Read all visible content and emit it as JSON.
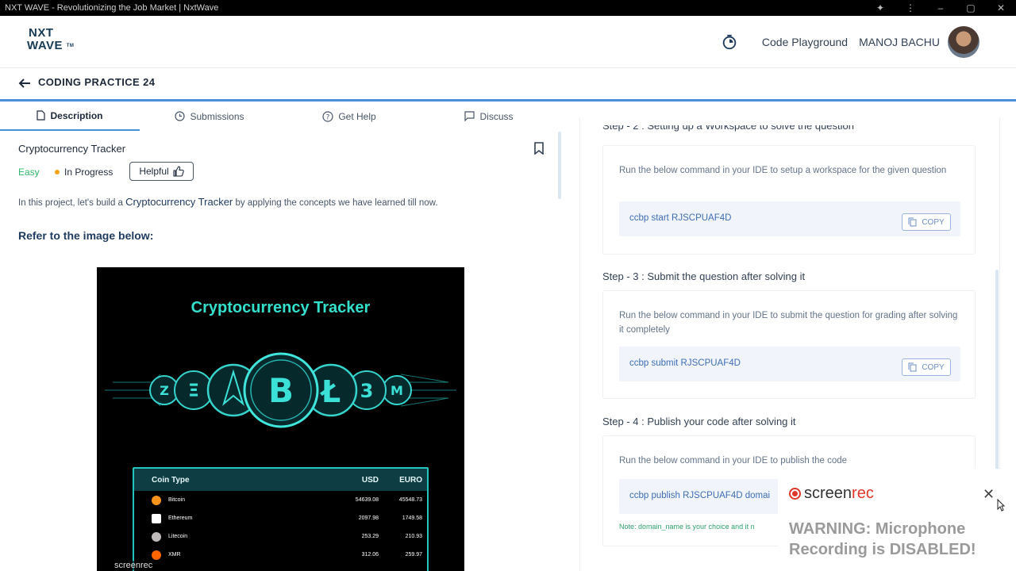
{
  "window": {
    "title": "NXT WAVE - Revolutionizing the Job Market | NxtWave"
  },
  "header": {
    "logo_line1": "NXT",
    "logo_line2": "WAVE",
    "logo_tm": "TM",
    "code_playground": "Code Playground",
    "username": "MANOJ BACHU"
  },
  "subheader": {
    "title": "CODING PRACTICE 24"
  },
  "tabs": [
    {
      "label": "Description"
    },
    {
      "label": "Submissions"
    },
    {
      "label": "Get Help"
    },
    {
      "label": "Discuss"
    }
  ],
  "question": {
    "title": "Cryptocurrency Tracker",
    "difficulty": "Easy",
    "status": "In Progress",
    "helpful_label": "Helpful",
    "intro_before": "In this project, let's build a ",
    "intro_strong": "Cryptocurrency Tracker",
    "intro_after": " by applying the concepts we have learned till now.",
    "refer": "Refer to the image below:"
  },
  "preview": {
    "title": "Cryptocurrency Tracker",
    "headers": [
      "Coin Type",
      "USD",
      "EURO"
    ],
    "rows": [
      {
        "name": "Bitcoin",
        "usd": "54639.08",
        "euro": "45548.73",
        "color": "#f7931a"
      },
      {
        "name": "Ethereum",
        "usd": "2097.98",
        "euro": "1749.58",
        "color": "#ffffff"
      },
      {
        "name": "Litecoin",
        "usd": "253.29",
        "euro": "210.93",
        "color": "#bfbbbb"
      },
      {
        "name": "XMR",
        "usd": "312.06",
        "euro": "259.97",
        "color": "#ff6600"
      }
    ],
    "watermark": "screenrec"
  },
  "steps": {
    "step2_heading": "Step - 2 : Setting up a Workspace to solve the question",
    "step2_text": "Run the below command in your IDE to setup a workspace for the given question",
    "step2_cmd": "ccbp start RJSCPUAF4D",
    "step3_heading": "Step - 3 : Submit the question after solving it",
    "step3_text": "Run the below command in your IDE to submit the question for grading after solving it completely",
    "step3_cmd": "ccbp submit RJSCPUAF4D",
    "step4_heading": "Step - 4 : Publish your code after solving it",
    "step4_text": "Run the below command in your IDE to publish the code",
    "step4_cmd": "ccbp publish RJSCPUAF4D domai",
    "step4_note": "Note: domain_name is your choice and it n",
    "copy_label": "COPY"
  },
  "popup": {
    "brand_a": "screen",
    "brand_b": "rec",
    "close": "✕",
    "warning": "WARNING: Microphone Recording is DISABLED!"
  }
}
